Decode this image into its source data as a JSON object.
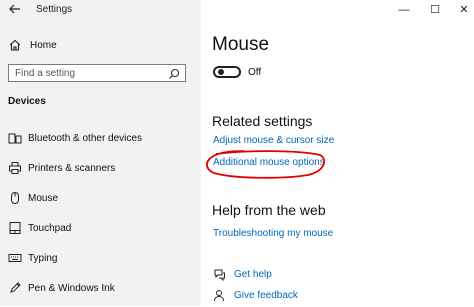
{
  "window": {
    "title": "Settings",
    "controls": {
      "minimize": "—",
      "maximize": "☐",
      "close": "✕"
    }
  },
  "sidebar": {
    "home_label": "Home",
    "search_placeholder": "Find a setting",
    "section_title": "Devices",
    "items": [
      {
        "label": "Bluetooth & other devices",
        "icon": "bluetooth-devices-icon"
      },
      {
        "label": "Printers & scanners",
        "icon": "printer-icon"
      },
      {
        "label": "Mouse",
        "icon": "mouse-icon"
      },
      {
        "label": "Touchpad",
        "icon": "touchpad-icon"
      },
      {
        "label": "Typing",
        "icon": "keyboard-icon"
      },
      {
        "label": "Pen & Windows Ink",
        "icon": "pen-icon"
      }
    ]
  },
  "main": {
    "title": "Mouse",
    "toggle_state_label": "Off",
    "related_settings": {
      "heading": "Related settings",
      "links": [
        "Adjust mouse & cursor size",
        "Additional mouse options"
      ]
    },
    "help": {
      "heading": "Help from the web",
      "links": [
        "Troubleshooting my mouse"
      ]
    },
    "footer_links": [
      "Get help",
      "Give feedback"
    ],
    "colors": {
      "link": "#0067b8",
      "annotation": "#e00000"
    }
  }
}
